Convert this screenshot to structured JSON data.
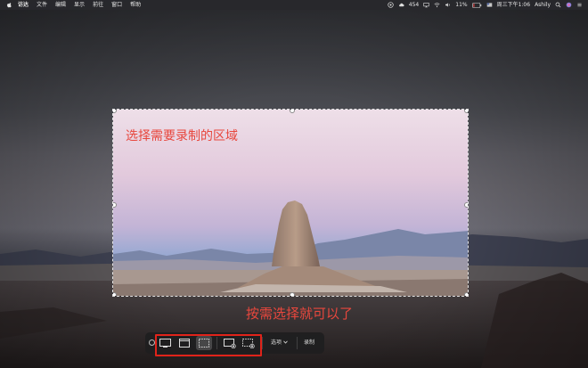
{
  "menubar": {
    "app_name": "访达",
    "items": [
      "文件",
      "编辑",
      "显示",
      "前往",
      "窗口",
      "帮助"
    ],
    "status_number": "454",
    "battery": "11%",
    "clock": "周三下午1:06",
    "user": "Ashily"
  },
  "annotations": {
    "select_region": "选择需要录制的区域",
    "select_as_needed": "按需选择就可以了"
  },
  "toolbar": {
    "options_label": "选项",
    "capture_label": "录制"
  },
  "colors": {
    "annotation": "#e8473d",
    "highlight_box": "#e0231a"
  }
}
